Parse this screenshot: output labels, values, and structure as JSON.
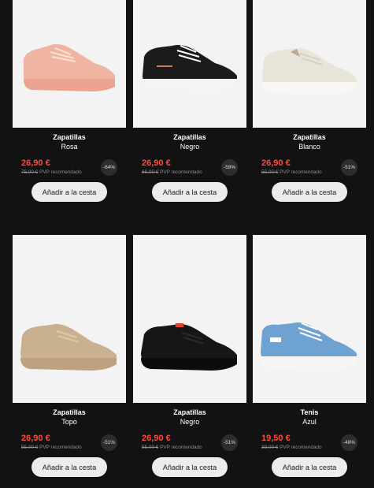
{
  "button_label": "Añadir a la cesta",
  "products": [
    {
      "name": "Zapatillas",
      "color": "Rosa",
      "price": "26,90 €",
      "old_price": "75,00 €",
      "pvp": "PVP recomendado",
      "discount": "-64%",
      "shoe_color": "#f0b4a3"
    },
    {
      "name": "Zapatillas",
      "color": "Negro",
      "price": "26,90 €",
      "old_price": "66,00 €",
      "pvp": "PVP recomendado",
      "discount": "-59%",
      "shoe_color": "#1b1b1b"
    },
    {
      "name": "Zapatillas",
      "color": "Blanco",
      "price": "26,90 €",
      "old_price": "55,00 €",
      "pvp": "PVP recomendado",
      "discount": "-51%",
      "shoe_color": "#e9e4da"
    },
    {
      "name": "Zapatillas",
      "color": "Topo",
      "price": "26,90 €",
      "old_price": "55,00 €",
      "pvp": "PVP recomendado",
      "discount": "-51%",
      "shoe_color": "#c9b190"
    },
    {
      "name": "Zapatillas",
      "color": "Negro",
      "price": "26,90 €",
      "old_price": "55,00 €",
      "pvp": "PVP recomendado",
      "discount": "-51%",
      "shoe_color": "#161616"
    },
    {
      "name": "Tenis",
      "color": "Azul",
      "price": "19,50 €",
      "old_price": "38,00 €",
      "pvp": "PVP recomendado",
      "discount": "-49%",
      "shoe_color": "#6ea3d1"
    }
  ],
  "colors": {
    "background": "#121212",
    "price": "#ff4a3d",
    "button_bg": "#ececec"
  }
}
